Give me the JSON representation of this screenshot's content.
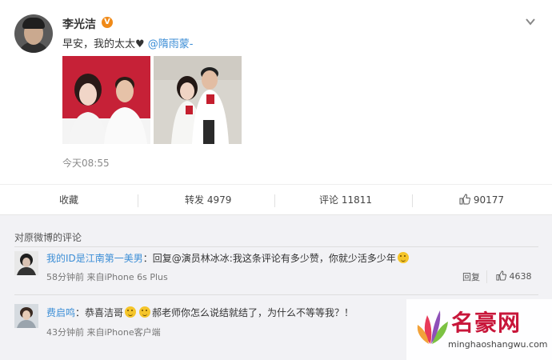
{
  "post": {
    "author": "李光洁",
    "verified_badge": "V",
    "text_prefix": "早安，我的太太♥ ",
    "mention": "@隋雨蒙-",
    "timestamp": "今天08:55",
    "photos": [
      "photo-couple-portrait",
      "photo-couple-certificates"
    ]
  },
  "actions": {
    "favorite": "收藏",
    "repost": "转发 4979",
    "comment": "评论 11811",
    "like_count": "90177"
  },
  "comments": {
    "title": "对原微博的评论",
    "items": [
      {
        "user": "我的ID是江南第一美男",
        "text": "：回复@演员林冰冰:我这条评论有多少赞，你就少活多少年",
        "meta": "58分钟前 来自iPhone 6s Plus",
        "reply": "回复",
        "likes": "4638"
      },
      {
        "user": "费启鸣",
        "text_a": "：恭喜洁哥",
        "text_b": "郝老师你怎么说结就结了，为什么不等等我？！",
        "meta": "43分钟前 来自iPhone客户端"
      }
    ]
  },
  "watermark": {
    "title": "名豪网",
    "url": "minghaoshangwu.com"
  },
  "colors": {
    "link": "#3c8ed6",
    "badge": "#f08a18",
    "watermark": "#c8163a"
  }
}
